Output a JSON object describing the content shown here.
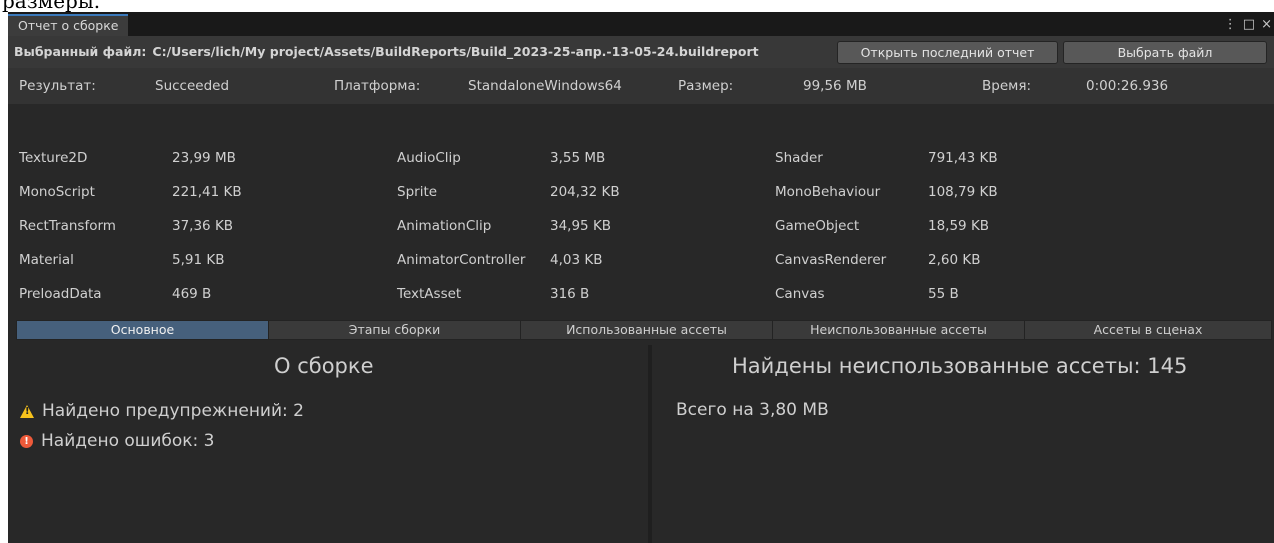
{
  "fragment_text": "размеры.",
  "window": {
    "tab_title": "Отчет о сборке",
    "menu_icon": "⋮",
    "maximize_icon": "□",
    "close_icon": "×"
  },
  "file": {
    "label": "Выбранный файл:",
    "path": "C:/Users/lich/My project/Assets/BuildReports/Build_2023-25-апр.-13-05-24.buildreport",
    "open_last_button": "Открыть последний отчет",
    "choose_button": "Выбрать файл"
  },
  "summary": {
    "result_label": "Результат:",
    "result_value": "Succeeded",
    "platform_label": "Платформа:",
    "platform_value": "StandaloneWindows64",
    "size_label": "Размер:",
    "size_value": "99,56 MB",
    "time_label": "Время:",
    "time_value": "0:00:26.936"
  },
  "stats": [
    {
      "name": "Texture2D",
      "size": "23,99 MB"
    },
    {
      "name": "AudioClip",
      "size": "3,55 MB"
    },
    {
      "name": "Shader",
      "size": "791,43 KB"
    },
    {
      "name": "MonoScript",
      "size": "221,41 KB"
    },
    {
      "name": "Sprite",
      "size": "204,32 KB"
    },
    {
      "name": "MonoBehaviour",
      "size": "108,79 KB"
    },
    {
      "name": "RectTransform",
      "size": "37,36 KB"
    },
    {
      "name": "AnimationClip",
      "size": "34,95 KB"
    },
    {
      "name": "GameObject",
      "size": "18,59 KB"
    },
    {
      "name": "Material",
      "size": "5,91 KB"
    },
    {
      "name": "AnimatorController",
      "size": "4,03 KB"
    },
    {
      "name": "CanvasRenderer",
      "size": "2,60 KB"
    },
    {
      "name": "PreloadData",
      "size": "469 B"
    },
    {
      "name": "TextAsset",
      "size": "316 B"
    },
    {
      "name": "Canvas",
      "size": "55 B"
    }
  ],
  "tabs": [
    {
      "label": "Основное",
      "active": true
    },
    {
      "label": "Этапы сборки",
      "active": false
    },
    {
      "label": "Использованные ассеты",
      "active": false
    },
    {
      "label": "Неиспользованные ассеты",
      "active": false
    },
    {
      "label": "Ассеты в сценах",
      "active": false
    }
  ],
  "about": {
    "title": "О сборке",
    "warnings_text": "Найдено предупрежнений: 2",
    "errors_text": "Найдено ошибок: 3"
  },
  "unused": {
    "title": "Найдены неиспользованные ассеты: 145",
    "total_text": "Всего на 3,80 MB"
  },
  "colors": {
    "background": "#282828",
    "active_tab": "#46607c",
    "accent": "#3a79bb",
    "warning": "#f7c21c",
    "error": "#ee5a3a"
  }
}
